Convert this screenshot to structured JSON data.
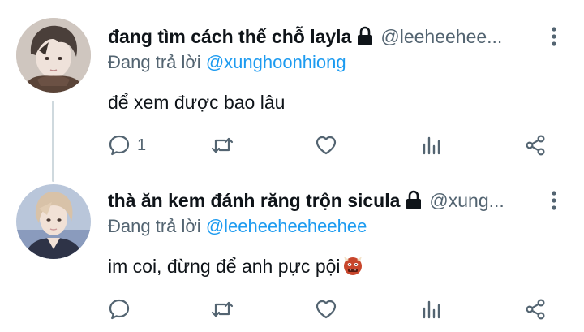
{
  "tweets": [
    {
      "display_name": "đang tìm cách thế chỗ layla",
      "handle": "@leeheehee...",
      "reply_prefix": "Đang trả lời",
      "reply_to": "@xunghoonhiong",
      "text": "để xem được bao lâu",
      "reply_count": "1",
      "avatar_icon": "avatar-photo-dark-hair",
      "lock_icon": "lock-icon"
    },
    {
      "display_name": "thà ăn kem đánh răng trộn sicula",
      "handle": "@xung...",
      "reply_prefix": "Đang trả lời",
      "reply_to": "@leeheeheeheehee",
      "text": "im coi, đừng để anh pực pội",
      "reply_count": "",
      "avatar_icon": "avatar-photo-light-hair",
      "lock_icon": "lock-icon",
      "emoji": "ogre-emoji"
    }
  ],
  "colors": {
    "text_primary": "#0f1419",
    "text_secondary": "#536471",
    "mention": "#1d9bf0",
    "thread_line": "#cfd9de"
  }
}
